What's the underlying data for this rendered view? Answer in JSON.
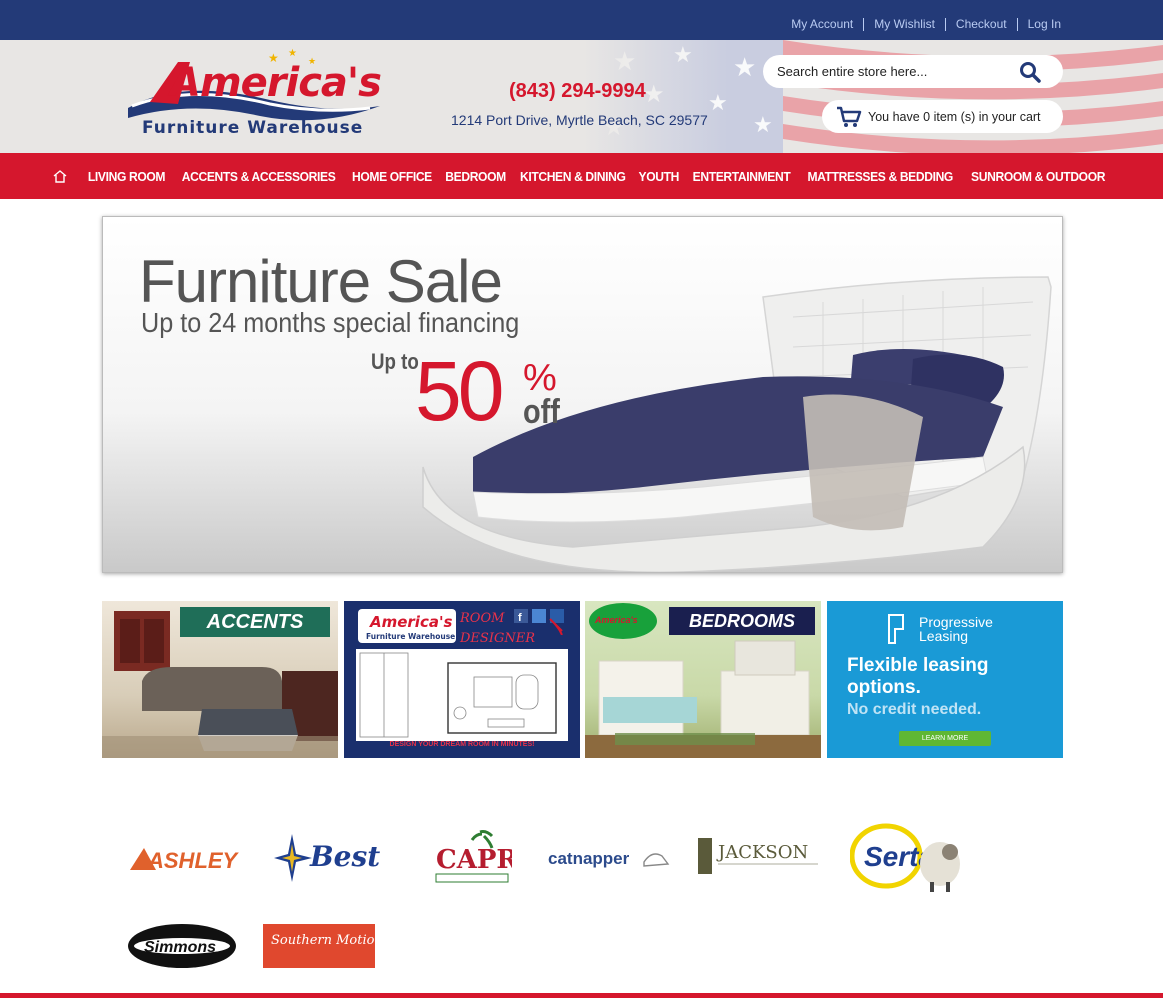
{
  "top_links": [
    "My Account",
    "My Wishlist",
    "Checkout",
    "Log In"
  ],
  "header": {
    "logo_top": "America's",
    "logo_bottom": "Furniture Warehouse",
    "phone": "(843) 294-9994",
    "address": "1214 Port Drive, Myrtle Beach, SC 29577",
    "search_placeholder": "Search entire store here...",
    "cart_text": "You have 0 item (s) in your cart"
  },
  "nav": [
    "LIVING ROOM",
    "ACCENTS & ACCESSORIES",
    "HOME OFFICE",
    "BEDROOM",
    "KITCHEN & DINING",
    "YOUTH",
    "ENTERTAINMENT",
    "MATTRESSES & BEDDING",
    "SUNROOM & OUTDOOR"
  ],
  "hero": {
    "title": "Furniture Sale",
    "subtitle": "Up to 24 months special financing",
    "up_to": "Up to",
    "percent": "50",
    "percent_sign": "%",
    "off": "off"
  },
  "tiles": {
    "accents": "ACCENTS",
    "room_designer_1": "ROOM",
    "room_designer_2": "DESIGNER",
    "room_designer_foot": "DESIGN YOUR DREAM ROOM IN MINUTES!",
    "bedrooms": "BEDROOMS",
    "progressive_1": "Progressive",
    "progressive_2": "Leasing",
    "progressive_big_1": "Flexible leasing",
    "progressive_big_2": "options.",
    "progressive_small": "No credit needed.",
    "progressive_btn": "LEARN MORE"
  },
  "brands": [
    "ASHLEY",
    "Best",
    "CAPRIS",
    "catnapper",
    "JACKSON",
    "Serta",
    "Simmons",
    "Southern Motion"
  ],
  "colors": {
    "navy": "#233a78",
    "red": "#d5172d",
    "progressive_blue": "#1a9ad6"
  }
}
